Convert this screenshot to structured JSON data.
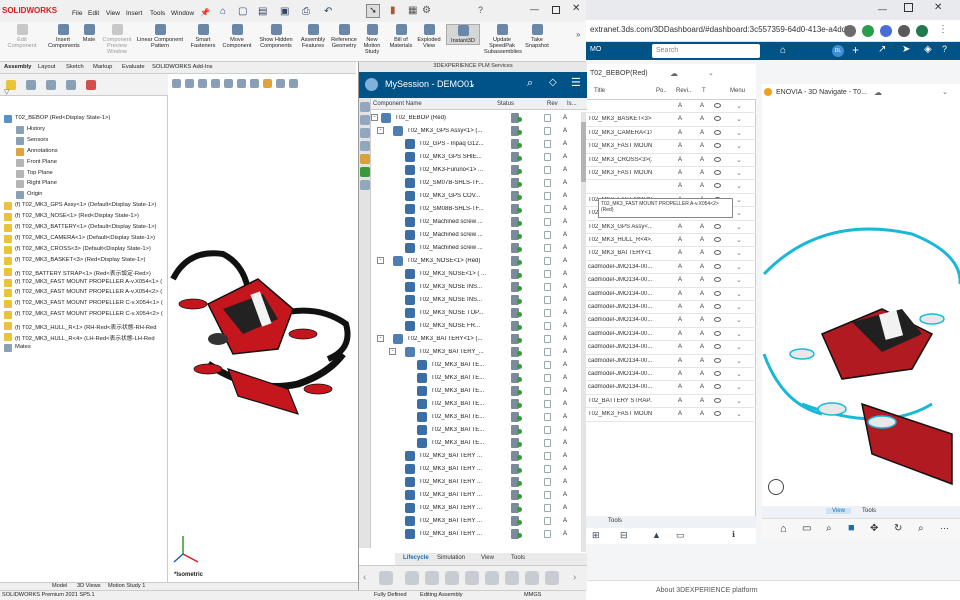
{
  "browser": {
    "url": "extranet.3ds.com/3DDashboard/#dashboard:3c557359-64d0-413e-a4dd-...",
    "dashboard_label": "MO",
    "search_placeholder": "Search",
    "user_initials": "DL",
    "footer": "About 3DEXPERIENCE platform"
  },
  "worklist": {
    "title": "T02_BEBOP(Red)",
    "columns": [
      "Title",
      "Po..",
      "Revi..",
      "T",
      "Menu"
    ],
    "rows": [
      {
        "title": "",
        "rev": "A",
        "a": "A"
      },
      {
        "title": "T02_MK3_BASKET<3>...",
        "rev": "A",
        "a": "A"
      },
      {
        "title": "T02_MK3_CAMERA<1>...",
        "rev": "A",
        "a": "A"
      },
      {
        "title": "T02_MK3_FAST MOUN...",
        "rev": "A",
        "a": "A"
      },
      {
        "title": "T02_MK3_CROSS<3>(...",
        "rev": "A",
        "a": "A"
      },
      {
        "title": "T02_MK3_FAST MOUN...",
        "rev": "A",
        "a": "A"
      },
      {
        "title": "",
        "rev": "A",
        "a": "A"
      },
      {
        "title": "T02_MK3_FAST MOUN...",
        "rev": "A",
        "a": "A"
      },
      {
        "title": "T02_MK3_NOSE<1>(R...",
        "rev": "A",
        "a": "A"
      },
      {
        "title": "T02_MK3_GPS Assy<...",
        "rev": "A",
        "a": "A"
      },
      {
        "title": "T02_MK3_HULL_R<4>...",
        "rev": "A",
        "a": "A"
      },
      {
        "title": "T02_MK3_BATTERY<1...",
        "rev": "A",
        "a": "A"
      },
      {
        "title": "cadmodel-JMO134-00...",
        "rev": "A",
        "a": "A"
      },
      {
        "title": "cadmodel-JMO134-00...",
        "rev": "A",
        "a": "A"
      },
      {
        "title": "cadmodel-JMO134-00...",
        "rev": "A",
        "a": "A"
      },
      {
        "title": "cadmodel-JMO134-00...",
        "rev": "A",
        "a": "A"
      },
      {
        "title": "cadmodel-JMO134-00...",
        "rev": "A",
        "a": "A"
      },
      {
        "title": "cadmodel-JMO134-00...",
        "rev": "A",
        "a": "A"
      },
      {
        "title": "cadmodel-JMO134-00...",
        "rev": "A",
        "a": "A"
      },
      {
        "title": "cadmodel-JMO134-00...",
        "rev": "A",
        "a": "A"
      },
      {
        "title": "cadmodel-JMO134-00...",
        "rev": "A",
        "a": "A"
      },
      {
        "title": "cadmodel-JMO134-00...",
        "rev": "A",
        "a": "A"
      },
      {
        "title": "T02_BATTERY STRAP...",
        "rev": "A",
        "a": "A"
      },
      {
        "title": "T02_MK3_FAST MOUN...",
        "rev": "A",
        "a": "A"
      }
    ],
    "tooltip": "T02_MK3_FAST MOUNT PROPELLER A-v.X054<2> (Red)",
    "tab_tools": "Tools"
  },
  "navigate": {
    "title": "ENOVIA - 3D Navigate - T0...",
    "tab_view": "View",
    "tab_tools": "Tools"
  },
  "sw": {
    "logo": "SOLIDWORKS",
    "menus": [
      "File",
      "Edit",
      "View",
      "Insert",
      "Tools",
      "Window"
    ],
    "commands": [
      {
        "label": "Edit Component",
        "dis": true
      },
      {
        "label": "Insert Components",
        "dis": false
      },
      {
        "label": "Mate",
        "dis": false
      },
      {
        "label": "Component Preview Window",
        "dis": true
      },
      {
        "label": "Linear Component Pattern",
        "dis": false
      },
      {
        "label": "Smart Fasteners",
        "dis": false
      },
      {
        "label": "Move Component",
        "dis": false
      },
      {
        "label": "Show Hidden Components",
        "dis": false
      },
      {
        "label": "Assembly Features",
        "dis": false
      },
      {
        "label": "Reference Geometry",
        "dis": false
      },
      {
        "label": "New Motion Study",
        "dis": false
      },
      {
        "label": "Bill of Materials",
        "dis": false
      },
      {
        "label": "Exploded View",
        "dis": false
      },
      {
        "label": "Instant3D",
        "dis": false
      },
      {
        "label": "Update SpeedPak Subassemblies",
        "dis": false
      },
      {
        "label": "Take Snapshot",
        "dis": false
      }
    ],
    "tabs": [
      "Assembly",
      "Layout",
      "Sketch",
      "Markup",
      "Evaluate",
      "SOLIDWORKS Add-Ins"
    ],
    "tree": [
      {
        "t": "T02_BEBOP  (Red<Display State-1>)",
        "lvl": 0,
        "c": "#5a8fc8"
      },
      {
        "t": "History",
        "lvl": 1,
        "c": "#8aa0b5"
      },
      {
        "t": "Sensors",
        "lvl": 1,
        "c": "#8aa0b5"
      },
      {
        "t": "Annotations",
        "lvl": 1,
        "c": "#e0a53a"
      },
      {
        "t": "Front Plane",
        "lvl": 1,
        "c": "#b5b5b5"
      },
      {
        "t": "Top Plane",
        "lvl": 1,
        "c": "#b5b5b5"
      },
      {
        "t": "Right Plane",
        "lvl": 1,
        "c": "#b5b5b5"
      },
      {
        "t": "Origin",
        "lvl": 1,
        "c": "#8aa0b5"
      },
      {
        "t": "(f) T02_MK3_GPS Assy<1> (Default<Display State-1>)",
        "lvl": 0,
        "c": "#e8c43a"
      },
      {
        "t": "(f) T02_MK3_NOSE<1> (Red<Display State-1>)",
        "lvl": 0,
        "c": "#e8c43a"
      },
      {
        "t": "(f) T02_MK3_BATTERY<1> (Default<Display State-1>)",
        "lvl": 0,
        "c": "#e8c43a"
      },
      {
        "t": "(f) T02_MK3_CAMERA<1> (Default<Display State-1>)",
        "lvl": 0,
        "c": "#e8c43a"
      },
      {
        "t": "(f) T02_MK3_CROSS<3> (Default<Display State-1>)",
        "lvl": 0,
        "c": "#e8c43a"
      },
      {
        "t": "(f) T02_MK3_BASKET<3> (Red<Display State-1>)",
        "lvl": 0,
        "c": "#e8c43a"
      },
      {
        "t": "(f) T02_BATTERY STRAP<1> (Red<表示設定-Red>)",
        "lvl": 0,
        "c": "#e8c43a"
      },
      {
        "t": "(f) T02_MK3_FAST MOUNT PROPELLER A-v.X054<1> (",
        "lvl": 0,
        "c": "#e8c43a"
      },
      {
        "t": "(f) T02_MK3_FAST MOUNT PROPELLER A-v.X054<2> (",
        "lvl": 0,
        "c": "#e8c43a"
      },
      {
        "t": "(f) T02_MK3_FAST MOUNT PROPELLER C-v.X054<1> (",
        "lvl": 0,
        "c": "#e8c43a"
      },
      {
        "t": "(f) T02_MK3_FAST MOUNT PROPELLER C-v.X054<2> (",
        "lvl": 0,
        "c": "#e8c43a"
      },
      {
        "t": "(f) T02_MK3_HULL_R<1> (RH-Red<表示状態-RH-Red",
        "lvl": 0,
        "c": "#e8c43a"
      },
      {
        "t": "(f) T02_MK3_HULL_R<4> (LH-Red<表示状態-LH-Red",
        "lvl": 0,
        "c": "#e8c43a"
      },
      {
        "t": "Mates",
        "lvl": 0,
        "c": "#8aa0b5"
      }
    ],
    "view_label": "*Isometric",
    "bottom_tabs": [
      "Model",
      "3D Views",
      "Motion Study 1"
    ],
    "status": {
      "version": "SOLIDWORKS Premium 2021 SP5.1",
      "defined": "Fully Defined",
      "editing": "Editing Assembly",
      "units": "MMGS"
    }
  },
  "plm": {
    "caption": "3DEXPERIENCE PLM Services",
    "title": "MySession - DEMO01",
    "columns": [
      "Component Name",
      "Status",
      "Rev",
      "Is..."
    ],
    "rows": [
      {
        "n": "T02_BEBOP (Red)",
        "lvl": 0,
        "tg": "-",
        "c": "#4f7fb2",
        "rev": "A"
      },
      {
        "n": "T02_MK3_GPS Assy<1> (...",
        "lvl": 1,
        "tg": "-",
        "c": "#4f7fb2",
        "rev": "A"
      },
      {
        "n": "T02_GPS - Inpaq G12...",
        "lvl": 2,
        "tg": "",
        "c": "#3b6ea5",
        "rev": "A"
      },
      {
        "n": "T02_MK3_GPS SHIE...",
        "lvl": 2,
        "tg": "",
        "c": "#3b6ea5",
        "rev": "A"
      },
      {
        "n": "T02_MK3-Furuno<1> ...",
        "lvl": 2,
        "tg": "",
        "c": "#3b6ea5",
        "rev": "A"
      },
      {
        "n": "T02_SM07B-SHLS-TF...",
        "lvl": 2,
        "tg": "",
        "c": "#3b6ea5",
        "rev": "A"
      },
      {
        "n": "T02_MK3_GPS COV...",
        "lvl": 2,
        "tg": "",
        "c": "#3b6ea5",
        "rev": "A"
      },
      {
        "n": "T02_SM08B-SHLS-TF...",
        "lvl": 2,
        "tg": "",
        "c": "#3b6ea5",
        "rev": "A"
      },
      {
        "n": "T02_Machined screw ...",
        "lvl": 2,
        "tg": "",
        "c": "#3b6ea5",
        "rev": "A"
      },
      {
        "n": "T02_Machined screw ...",
        "lvl": 2,
        "tg": "",
        "c": "#3b6ea5",
        "rev": "A"
      },
      {
        "n": "T02_Machined screw ...",
        "lvl": 2,
        "tg": "",
        "c": "#3b6ea5",
        "rev": "A"
      },
      {
        "n": "T02_MK3_NOSE<1> (Red)",
        "lvl": 1,
        "tg": "-",
        "c": "#4f7fb2",
        "rev": "A"
      },
      {
        "n": "T02_MK3_NOSE<1> ( ...",
        "lvl": 2,
        "tg": "",
        "c": "#3b6ea5",
        "rev": "A"
      },
      {
        "n": "T02_MK3_NOSE INS...",
        "lvl": 2,
        "tg": "",
        "c": "#3b6ea5",
        "rev": "A"
      },
      {
        "n": "T02_MK3_NOSE INS...",
        "lvl": 2,
        "tg": "",
        "c": "#3b6ea5",
        "rev": "A"
      },
      {
        "n": "T02_MK3_NOSE TOP...",
        "lvl": 2,
        "tg": "",
        "c": "#3b6ea5",
        "rev": "A"
      },
      {
        "n": "T02_MK3_NOSE FR...",
        "lvl": 2,
        "tg": "",
        "c": "#3b6ea5",
        "rev": "A"
      },
      {
        "n": "T02_MK3_BATTERY<1> (...",
        "lvl": 1,
        "tg": "-",
        "c": "#4f7fb2",
        "rev": "A"
      },
      {
        "n": "T02_MK3_BATTERY_...",
        "lvl": 2,
        "tg": "-",
        "c": "#4f7fb2",
        "rev": "A"
      },
      {
        "n": "T02_MK3_BATTE...",
        "lvl": 3,
        "tg": "",
        "c": "#3b6ea5",
        "rev": "A"
      },
      {
        "n": "T02_MK3_BATTE...",
        "lvl": 3,
        "tg": "",
        "c": "#3b6ea5",
        "rev": "A"
      },
      {
        "n": "T02_MK3_BATTE...",
        "lvl": 3,
        "tg": "",
        "c": "#3b6ea5",
        "rev": "A"
      },
      {
        "n": "T02_MK3_BATTE...",
        "lvl": 3,
        "tg": "",
        "c": "#3b6ea5",
        "rev": "A"
      },
      {
        "n": "T02_MK3_BATTE...",
        "lvl": 3,
        "tg": "",
        "c": "#3b6ea5",
        "rev": "A"
      },
      {
        "n": "T02_MK3_BATTE...",
        "lvl": 3,
        "tg": "",
        "c": "#3b6ea5",
        "rev": "A"
      },
      {
        "n": "T02_MK3_BATTE...",
        "lvl": 3,
        "tg": "",
        "c": "#3b6ea5",
        "rev": "A"
      },
      {
        "n": "T02_MK3_BATTERY ...",
        "lvl": 2,
        "tg": "",
        "c": "#3b6ea5",
        "rev": "A"
      },
      {
        "n": "T02_MK3_BATTERY ...",
        "lvl": 2,
        "tg": "",
        "c": "#3b6ea5",
        "rev": "A"
      },
      {
        "n": "T02_MK3_BATTERY ...",
        "lvl": 2,
        "tg": "",
        "c": "#3b6ea5",
        "rev": "A"
      },
      {
        "n": "T02_MK3_BATTERY ...",
        "lvl": 2,
        "tg": "",
        "c": "#3b6ea5",
        "rev": "A"
      },
      {
        "n": "T02_MK3_BATTERY ...",
        "lvl": 2,
        "tg": "",
        "c": "#3b6ea5",
        "rev": "A"
      },
      {
        "n": "T02_MK3_BATTERY ...",
        "lvl": 2,
        "tg": "",
        "c": "#3b6ea5",
        "rev": "A"
      },
      {
        "n": "T02_MK3_BATTERY ...",
        "lvl": 2,
        "tg": "",
        "c": "#3b6ea5",
        "rev": "A"
      }
    ],
    "tabs": [
      "Lifecycle",
      "Simulation",
      "View",
      "Tools"
    ]
  },
  "colors": {
    "brand_blue": "#005386",
    "sw_red": "#d41e1e",
    "drone_red": "#c4161c"
  }
}
